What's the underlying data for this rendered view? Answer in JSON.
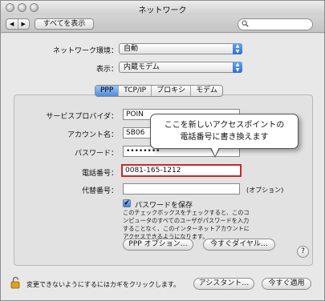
{
  "window": {
    "title": "ネットワーク"
  },
  "toolbar": {
    "back_label": "◀",
    "forward_label": "▶",
    "show_all_label": "すべてを表示",
    "search_placeholder": ""
  },
  "settings": {
    "location_label": "ネットワーク環境：",
    "location_value": "自動",
    "show_label": "表示：",
    "show_value": "内蔵モデム"
  },
  "tabs": [
    "PPP",
    "TCP/IP",
    "プロキシ",
    "モデム"
  ],
  "form": {
    "provider_label": "サービスプロバイダ：",
    "provider_value": "POIN",
    "account_label": "アカウント名：",
    "account_value": "SB06",
    "password_label": "パスワード：",
    "password_value": "••••••••",
    "phone_label": "電話番号：",
    "phone_value": "0081-165-1212",
    "alt_phone_label": "代替番号：",
    "alt_phone_value": "",
    "optional_text": "(オプション)"
  },
  "tooltip": {
    "line1": "ここを新しいアクセスポイントの",
    "line2": "電話番号に書き換えます"
  },
  "save_password": {
    "label": "パスワードを保存",
    "checked": true,
    "description": "このチェックボックスをチェックすると、このコンピュータのすべてのユーザがパスワードを入力することなく、このインターネットアカウントにアクセスできるようになります。"
  },
  "buttons": {
    "ppp_options": "PPP オプション…",
    "dial_now": "今すぐダイヤル…",
    "help": "?",
    "assistant": "アシスタント…",
    "apply_now": "今すぐ適用"
  },
  "footer": {
    "lock_text": "変更できないようにするにはカギをクリックします。"
  },
  "colors": {
    "highlight_border": "#c9272d",
    "selected_tab": "#4d8ce0"
  }
}
